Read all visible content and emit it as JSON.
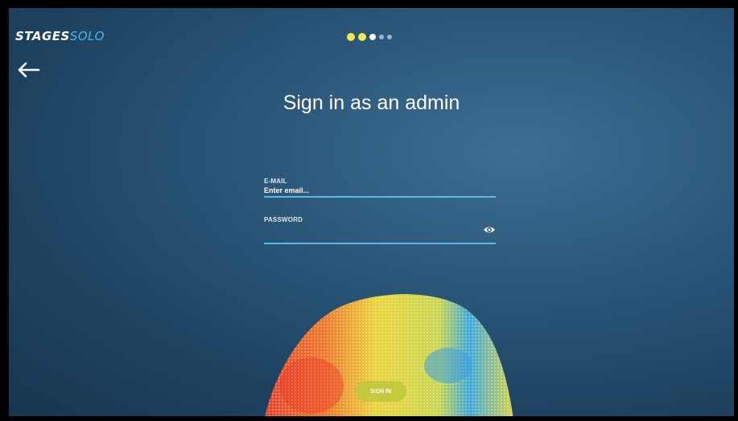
{
  "brand": {
    "logo_part1": "STAGES",
    "logo_part2": "SOLO"
  },
  "pagination": {
    "total_steps": 5,
    "current_step": 3
  },
  "header": {
    "title": "Sign in as an admin",
    "back_icon": "arrow-left-icon"
  },
  "form": {
    "email": {
      "label": "E-MAIL",
      "placeholder": "Enter email...",
      "value": ""
    },
    "password": {
      "label": "PASSWORD",
      "value": "",
      "toggle_icon": "eye-icon"
    },
    "submit_label": "SIGN IN"
  },
  "colors": {
    "accent_blue": "#5bb8e6",
    "dot_active": "#f4e84a",
    "button": "#bec83c",
    "background": "#2a5678"
  }
}
